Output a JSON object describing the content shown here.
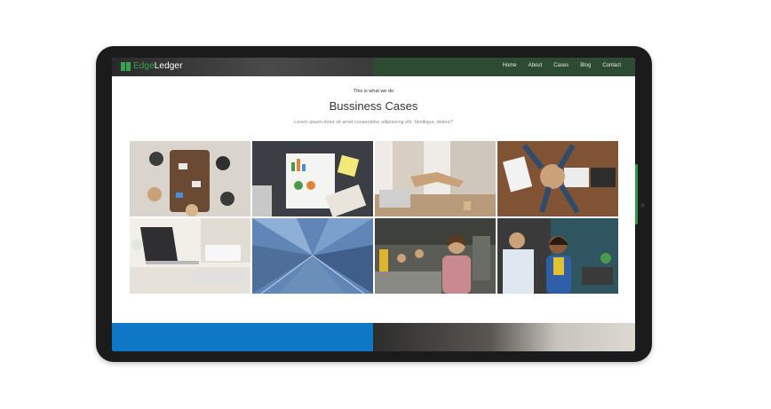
{
  "brand": {
    "prefix": "Edge",
    "suffix": "Ledger",
    "accent": "#3aa34f"
  },
  "nav": {
    "items": [
      "Home",
      "About",
      "Cases",
      "Blog",
      "Contact"
    ]
  },
  "section": {
    "eyebrow": "This is what we do",
    "title": "Bussiness Cases",
    "subtitle": "Lorem ipsum dolor sit amet consectetur adipisicing elit. Similique, dolore?"
  },
  "gallery": {
    "tiles": [
      "team-meeting-photo",
      "charts-paperwork-photo",
      "handshake-photo",
      "hands-together-photo",
      "laptop-desk-photo",
      "skyscrapers-photo",
      "businesswoman-office-photo",
      "smiling-employee-photo"
    ]
  },
  "colors": {
    "nav_right": "#2d4a33",
    "footer_blue": "#0f78c6",
    "tablet": "#1b1b1c"
  }
}
